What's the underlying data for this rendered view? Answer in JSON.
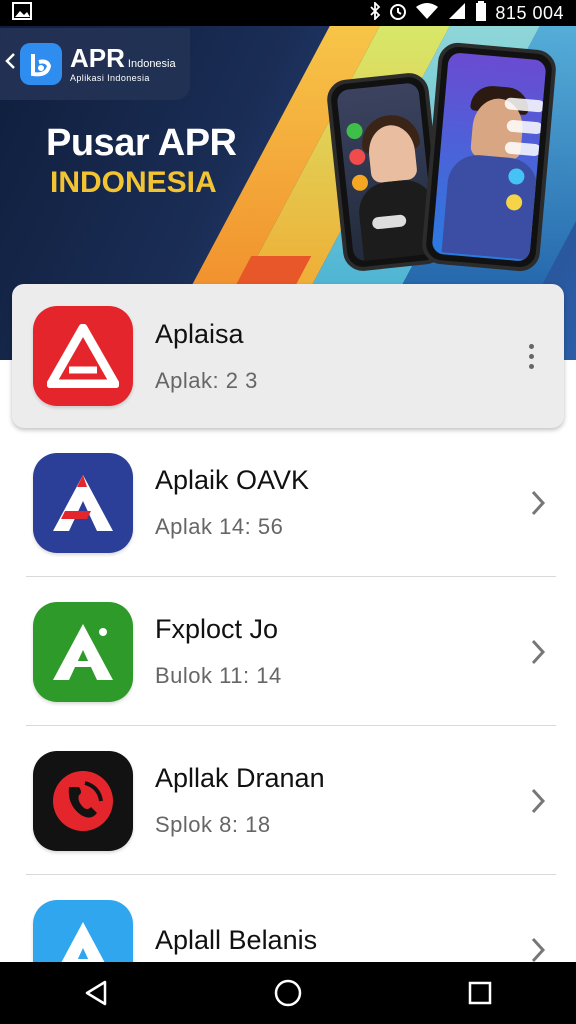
{
  "status_bar": {
    "time": "815 004",
    "icons": [
      "gallery-icon",
      "bluetooth-icon",
      "alarm-icon",
      "wifi-icon",
      "signal-icon",
      "battery-icon"
    ]
  },
  "banner": {
    "brand_main": "APR",
    "brand_side": "Indonesia",
    "brand_sub": "Aplikasi Indonesia",
    "title": "Pusar APR",
    "subtitle": "INDONESIA",
    "title_color": "#ffffff",
    "subtitle_color": "#f2c432"
  },
  "apps": [
    {
      "name": "Aplaisa",
      "meta": "Aplak: 2 3",
      "icon": "a-logo-icon",
      "icon_bg": "#e4262c",
      "action": "more-options"
    },
    {
      "name": "Aplaik OAVK",
      "meta": "Aplak 14: 56",
      "icon": "a-logo-icon",
      "icon_bg": "#2c3f98",
      "action": "chevron"
    },
    {
      "name": "Fxploct Jo",
      "meta": "Bulok 11: 14",
      "icon": "a-logo-icon",
      "icon_bg": "#2e9a2a",
      "action": "chevron"
    },
    {
      "name": "Apllak Dranan",
      "meta": "Splok 8: 18",
      "icon": "phone-swirl-icon",
      "icon_bg": "#121212",
      "action": "chevron"
    },
    {
      "name": "Aplall Belanis",
      "meta": "",
      "icon": "a-logo-icon",
      "icon_bg": "#2fa6ee",
      "action": "chevron"
    }
  ],
  "nav_bar": {
    "back": "back-icon",
    "home": "home-icon",
    "recents": "recents-icon"
  }
}
